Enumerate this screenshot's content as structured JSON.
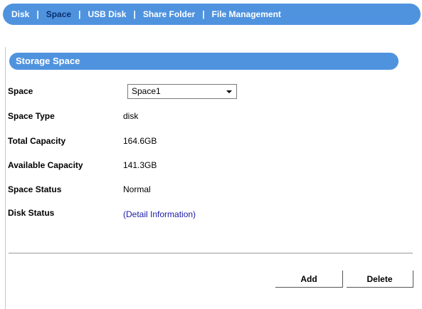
{
  "nav": {
    "items": [
      {
        "label": "Disk"
      },
      {
        "label": "Space"
      },
      {
        "label": "USB Disk"
      },
      {
        "label": "Share Folder"
      },
      {
        "label": "File Management"
      }
    ],
    "separator": "|"
  },
  "panel": {
    "title": "Storage Space",
    "fields": {
      "space": {
        "label": "Space",
        "value": "Space1"
      },
      "space_type": {
        "label": "Space Type",
        "value": "disk"
      },
      "total_capacity": {
        "label": "Total Capacity",
        "value": "164.6GB"
      },
      "available_capacity": {
        "label": "Available Capacity",
        "value": "141.3GB"
      },
      "space_status": {
        "label": "Space Status",
        "value": "Normal"
      },
      "disk_status": {
        "label": "Disk Status",
        "value": "(Detail Information)"
      }
    },
    "buttons": {
      "add": "Add",
      "delete": "Delete"
    }
  },
  "colors": {
    "nav_bg": "#4f93df",
    "active_nav_text": "#0b2f6e",
    "link": "#1a1aa6"
  }
}
